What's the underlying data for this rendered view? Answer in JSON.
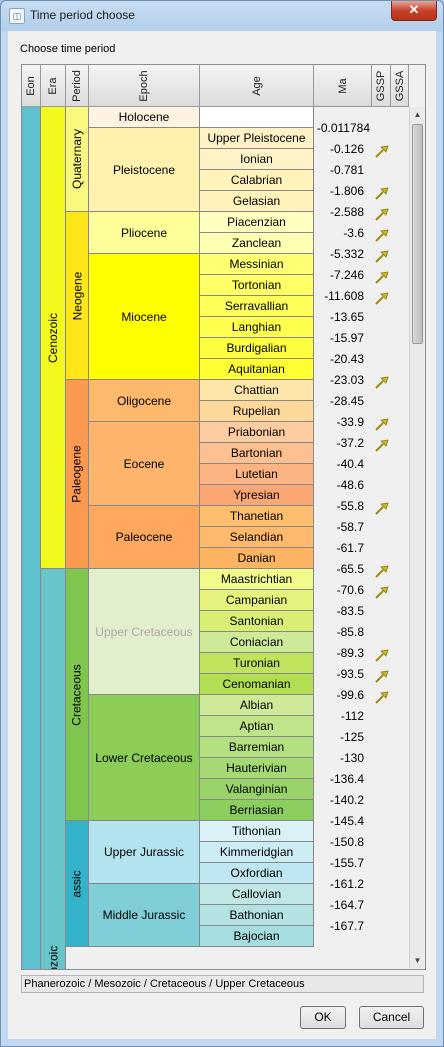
{
  "window": {
    "title": "Time period choose",
    "close_label": "✕",
    "app_icon": "window-icon"
  },
  "dialog": {
    "choose_label": "Choose time period",
    "selected_path": "Phanerozoic / Mesozoic / Cretaceous / Upper Cretaceous",
    "ok_label": "OK",
    "cancel_label": "Cancel"
  },
  "columns": [
    "Eon",
    "Era",
    "Period",
    "Epoch",
    "Age",
    "Ma",
    "GSSP",
    "GSSA"
  ],
  "colors": {
    "eon": "#5fc0cf",
    "cenozoic": "#f2f91d",
    "mesozoic": "#67c5ca",
    "quaternary": "#f9f97f",
    "neogene": "#ffe619",
    "paleogene": "#fd9a52",
    "cretaceous": "#7fc64e",
    "jurassic": "#34b2c9",
    "gssp_marker": "#c8b82b"
  },
  "eras": [
    {
      "name": "Cenozoic",
      "color": "#f2f91d"
    },
    {
      "name": "Mesozoic",
      "color": "#67c5ca"
    }
  ],
  "periods": [
    {
      "name": "Quaternary",
      "color": "#f9f97f"
    },
    {
      "name": "Neogene",
      "color": "#ffe619"
    },
    {
      "name": "Paleogene",
      "color": "#fd9a52"
    },
    {
      "name": "Cretaceous",
      "color": "#7fc64e"
    },
    {
      "name": "Jurassic",
      "color": "#34b2c9",
      "visible_text": "assic"
    }
  ],
  "epochs": [
    {
      "name": "Holocene",
      "color": "#fef2e0"
    },
    {
      "name": "Pleistocene",
      "color": "#fff2ae"
    },
    {
      "name": "Pliocene",
      "color": "#ffff99"
    },
    {
      "name": "Miocene",
      "color": "#ffff00"
    },
    {
      "name": "Oligocene",
      "color": "#feb96c"
    },
    {
      "name": "Eocene",
      "color": "#fdb46c"
    },
    {
      "name": "Paleocene",
      "color": "#fda75f"
    },
    {
      "name": "Upper Cretaceous",
      "color": "#e2efcd",
      "selected": true
    },
    {
      "name": "Lower Cretaceous",
      "color": "#8ccd57"
    },
    {
      "name": "Upper Jurassic",
      "color": "#b3e3ee"
    },
    {
      "name": "Middle Jurassic",
      "color": "#80cfd8"
    }
  ],
  "ages": [
    {
      "name": "Upper Pleistocene",
      "color": "#fff2c7"
    },
    {
      "name": "Ionian",
      "color": "#fff2c7"
    },
    {
      "name": "Calabrian",
      "color": "#fff2ba"
    },
    {
      "name": "Gelasian",
      "color": "#fff2ba"
    },
    {
      "name": "Piacenzian",
      "color": "#ffffbf"
    },
    {
      "name": "Zanclean",
      "color": "#ffffb3"
    },
    {
      "name": "Messinian",
      "color": "#ffff73"
    },
    {
      "name": "Tortonian",
      "color": "#ffff66"
    },
    {
      "name": "Serravallian",
      "color": "#ffff59"
    },
    {
      "name": "Langhian",
      "color": "#ffff4d"
    },
    {
      "name": "Burdigalian",
      "color": "#ffff41"
    },
    {
      "name": "Aquitanian",
      "color": "#ffff33"
    },
    {
      "name": "Chattian",
      "color": "#fee6aa"
    },
    {
      "name": "Rupelian",
      "color": "#fed99a"
    },
    {
      "name": "Priabonian",
      "color": "#fdcda1"
    },
    {
      "name": "Bartonian",
      "color": "#fdc091"
    },
    {
      "name": "Lutetian",
      "color": "#fcb482"
    },
    {
      "name": "Ypresian",
      "color": "#fca773"
    },
    {
      "name": "Thanetian",
      "color": "#fdbf6f"
    },
    {
      "name": "Selandian",
      "color": "#feb96c"
    },
    {
      "name": "Danian",
      "color": "#fdb462"
    },
    {
      "name": "Maastrichtian",
      "color": "#f2fa8c"
    },
    {
      "name": "Campanian",
      "color": "#e6f47f"
    },
    {
      "name": "Santonian",
      "color": "#d9ef74"
    },
    {
      "name": "Coniacian",
      "color": "#ccea97"
    },
    {
      "name": "Turonian",
      "color": "#bfe35d"
    },
    {
      "name": "Cenomanian",
      "color": "#b3de53"
    },
    {
      "name": "Albian",
      "color": "#ccea97"
    },
    {
      "name": "Aptian",
      "color": "#bfe48a"
    },
    {
      "name": "Barremian",
      "color": "#b3df7f"
    },
    {
      "name": "Hauterivian",
      "color": "#a6d975"
    },
    {
      "name": "Valanginian",
      "color": "#99d36a"
    },
    {
      "name": "Berriasian",
      "color": "#8ccd60"
    },
    {
      "name": "Tithonian",
      "color": "#d9f1f7"
    },
    {
      "name": "Kimmeridgian",
      "color": "#ccecf4"
    },
    {
      "name": "Oxfordian",
      "color": "#bfe7f1"
    },
    {
      "name": "Callovian",
      "color": "#bfe7e5"
    },
    {
      "name": "Bathonian",
      "color": "#b3e2e3"
    },
    {
      "name": "Bajocian",
      "color": "#a6dde0"
    }
  ],
  "ma_values": [
    "-0.011784",
    "-0.126",
    "-0.781",
    "-1.806",
    "-2.588",
    "-3.6",
    "-5.332",
    "-7.246",
    "-11.608",
    "-13.65",
    "-15.97",
    "-20.43",
    "-23.03",
    "-28.45",
    "-33.9",
    "-37.2",
    "-40.4",
    "-48.6",
    "-55.8",
    "-58.7",
    "-61.7",
    "-65.5",
    "-70.6",
    "-83.5",
    "-85.8",
    "-89.3",
    "-93.5",
    "-99.6",
    "-112",
    "-125",
    "-130",
    "-136.4",
    "-140.2",
    "-145.4",
    "-150.8",
    "-155.7",
    "-161.2",
    "-164.7",
    "-167.7"
  ],
  "gssp_flags": [
    "-0.126",
    "-1.806",
    "-2.588",
    "-3.6",
    "-5.332",
    "-7.246",
    "-11.608",
    "-23.03",
    "-33.9",
    "-37.2",
    "-55.8",
    "-65.5",
    "-70.6",
    "-89.3",
    "-93.5",
    "-99.6"
  ],
  "scrollbar": {
    "up_icon": "▲",
    "down_icon": "▼"
  }
}
